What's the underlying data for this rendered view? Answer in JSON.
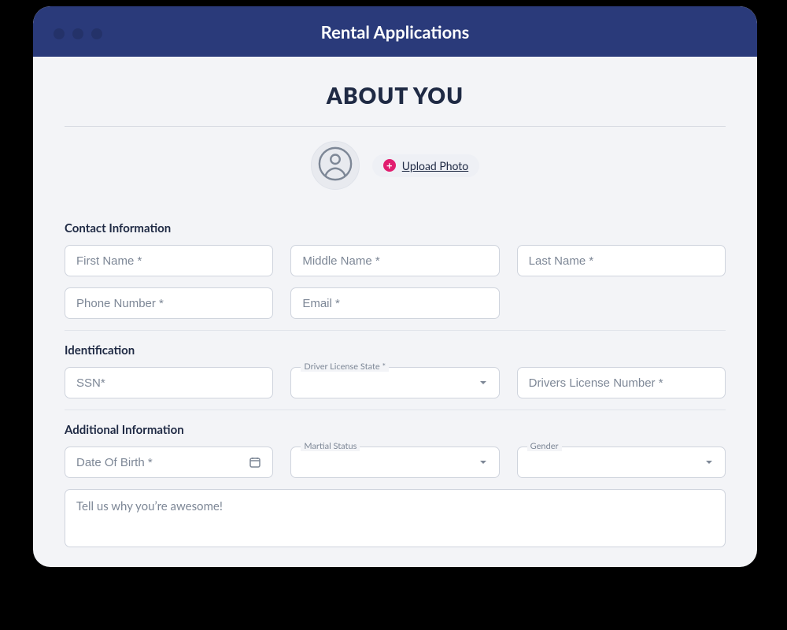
{
  "window": {
    "title": "Rental Applications"
  },
  "page": {
    "heading": "ABOUT YOU"
  },
  "photo": {
    "upload_label": "Upload Photo"
  },
  "sections": {
    "contact": {
      "title": "Contact Information",
      "first_name_ph": "First Name *",
      "middle_name_ph": "Middle Name *",
      "last_name_ph": "Last Name *",
      "phone_ph": "Phone Number *",
      "email_ph": "Email *"
    },
    "ident": {
      "title": "Identification",
      "ssn_ph": "SSN*",
      "dl_state_label": "Driver License State *",
      "dl_number_ph": "Drivers License Number *"
    },
    "additional": {
      "title": "Additional Information",
      "dob_ph": "Date Of Birth *",
      "martial_label": "Martial Status",
      "gender_label": "Gender",
      "about_ph": "Tell us why you’re awesome!"
    }
  }
}
